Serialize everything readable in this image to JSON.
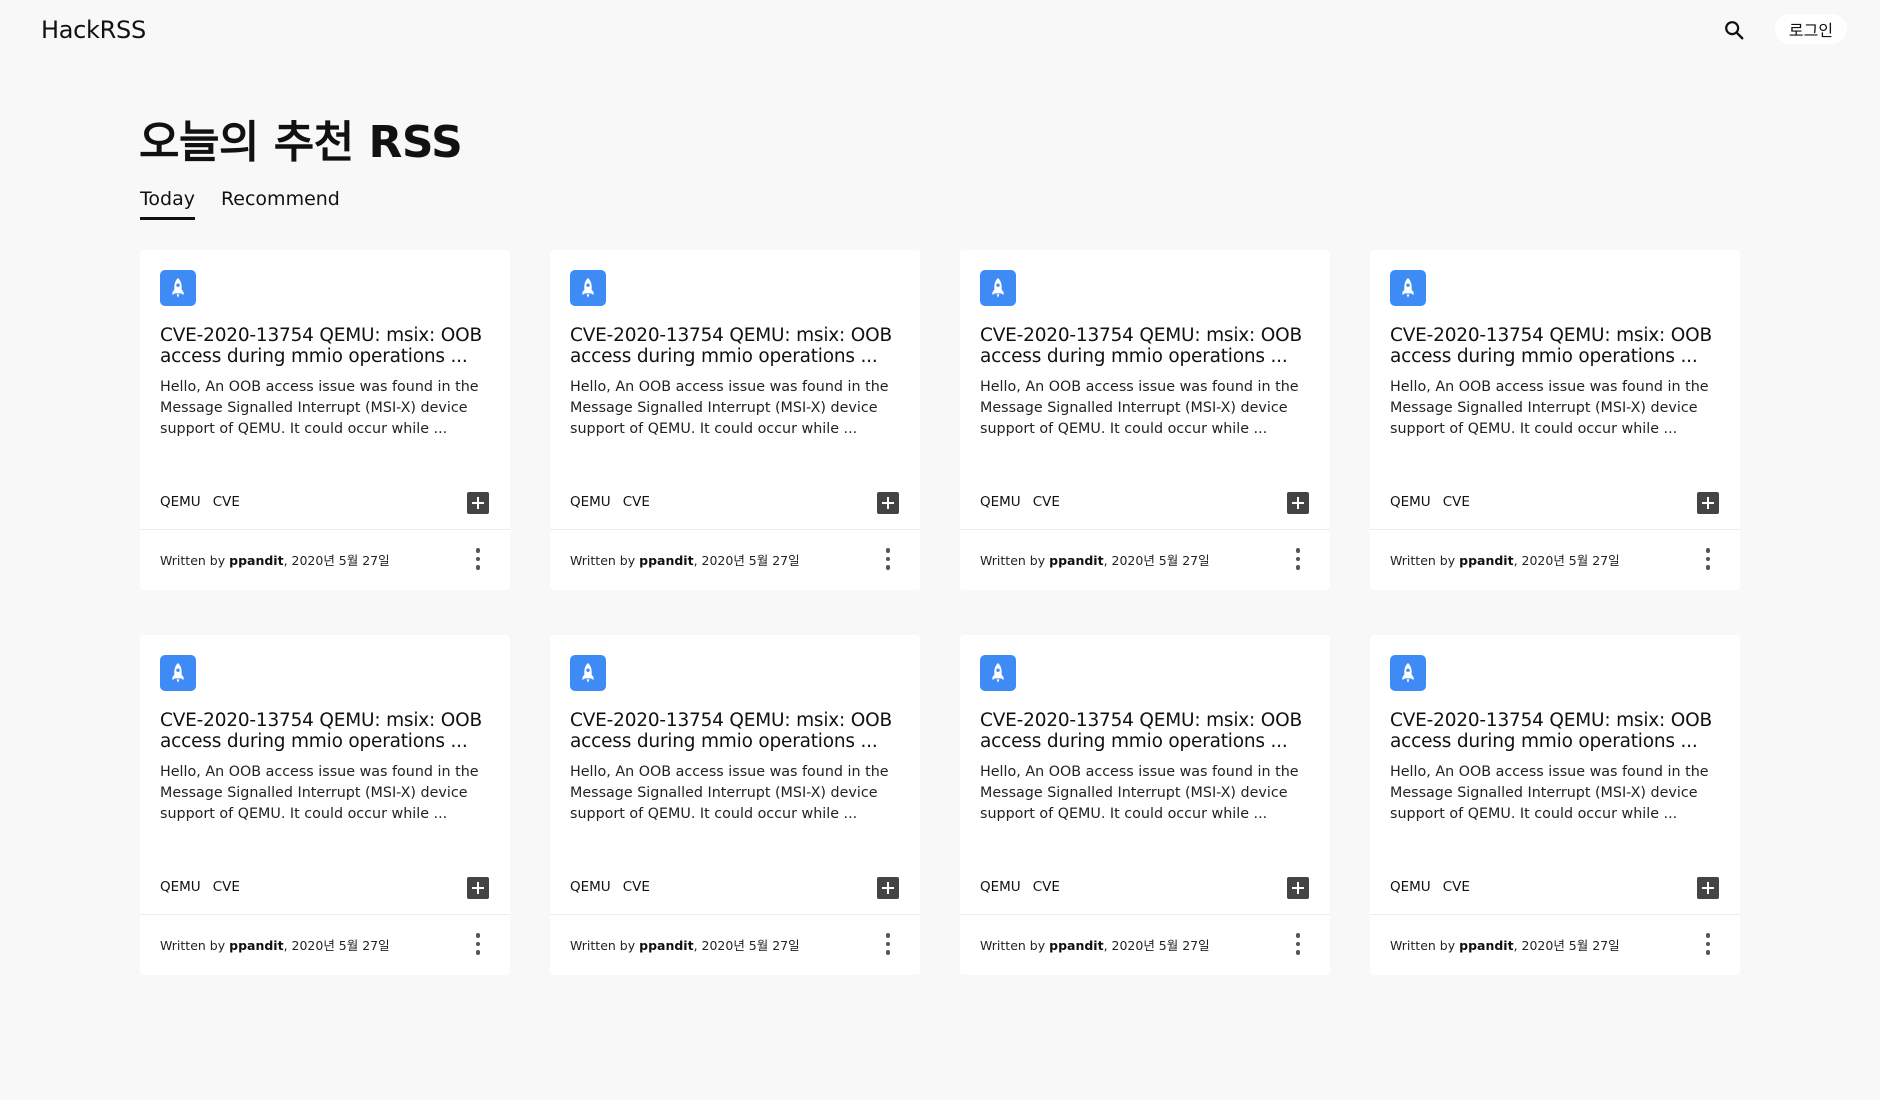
{
  "header": {
    "logo": "HackRSS",
    "login_label": "로그인"
  },
  "page_title": "오늘의 추천 RSS",
  "tabs": [
    {
      "label": "Today",
      "active": true
    },
    {
      "label": "Recommend",
      "active": false
    }
  ],
  "colors": {
    "accent": "#3f8bf5",
    "background": "#f8f8f8",
    "card": "#ffffff"
  },
  "cards": [
    {
      "icon": "rocket-icon",
      "title": "CVE-2020-13754 QEMU: msix: OOB access during mmio operations ...",
      "description": "Hello, An OOB access issue was found in the Message Signalled Interrupt (MSI-X) device support of QEMU. It could occur while ...",
      "tags": [
        "QEMU",
        "CVE"
      ],
      "written_by": "Written by",
      "author": "ppandit",
      "date": ", 2020년 5월 27일"
    },
    {
      "icon": "rocket-icon",
      "title": "CVE-2020-13754 QEMU: msix: OOB access during mmio operations ...",
      "description": "Hello, An OOB access issue was found in the Message Signalled Interrupt (MSI-X) device support of QEMU. It could occur while ...",
      "tags": [
        "QEMU",
        "CVE"
      ],
      "written_by": "Written by",
      "author": "ppandit",
      "date": ", 2020년 5월 27일"
    },
    {
      "icon": "rocket-icon",
      "title": "CVE-2020-13754 QEMU: msix: OOB access during mmio operations ...",
      "description": "Hello, An OOB access issue was found in the Message Signalled Interrupt (MSI-X) device support of QEMU. It could occur while ...",
      "tags": [
        "QEMU",
        "CVE"
      ],
      "written_by": "Written by",
      "author": "ppandit",
      "date": ", 2020년 5월 27일"
    },
    {
      "icon": "rocket-icon",
      "title": "CVE-2020-13754 QEMU: msix: OOB access during mmio operations ...",
      "description": "Hello, An OOB access issue was found in the Message Signalled Interrupt (MSI-X) device support of QEMU. It could occur while ...",
      "tags": [
        "QEMU",
        "CVE"
      ],
      "written_by": "Written by",
      "author": "ppandit",
      "date": ", 2020년 5월 27일"
    },
    {
      "icon": "rocket-icon",
      "title": "CVE-2020-13754 QEMU: msix: OOB access during mmio operations ...",
      "description": "Hello, An OOB access issue was found in the Message Signalled Interrupt (MSI-X) device support of QEMU. It could occur while ...",
      "tags": [
        "QEMU",
        "CVE"
      ],
      "written_by": "Written by",
      "author": "ppandit",
      "date": ", 2020년 5월 27일"
    },
    {
      "icon": "rocket-icon",
      "title": "CVE-2020-13754 QEMU: msix: OOB access during mmio operations ...",
      "description": "Hello, An OOB access issue was found in the Message Signalled Interrupt (MSI-X) device support of QEMU. It could occur while ...",
      "tags": [
        "QEMU",
        "CVE"
      ],
      "written_by": "Written by",
      "author": "ppandit",
      "date": ", 2020년 5월 27일"
    },
    {
      "icon": "rocket-icon",
      "title": "CVE-2020-13754 QEMU: msix: OOB access during mmio operations ...",
      "description": "Hello, An OOB access issue was found in the Message Signalled Interrupt (MSI-X) device support of QEMU. It could occur while ...",
      "tags": [
        "QEMU",
        "CVE"
      ],
      "written_by": "Written by",
      "author": "ppandit",
      "date": ", 2020년 5월 27일"
    },
    {
      "icon": "rocket-icon",
      "title": "CVE-2020-13754 QEMU: msix: OOB access during mmio operations ...",
      "description": "Hello, An OOB access issue was found in the Message Signalled Interrupt (MSI-X) device support of QEMU. It could occur while ...",
      "tags": [
        "QEMU",
        "CVE"
      ],
      "written_by": "Written by",
      "author": "ppandit",
      "date": ", 2020년 5월 27일"
    }
  ]
}
